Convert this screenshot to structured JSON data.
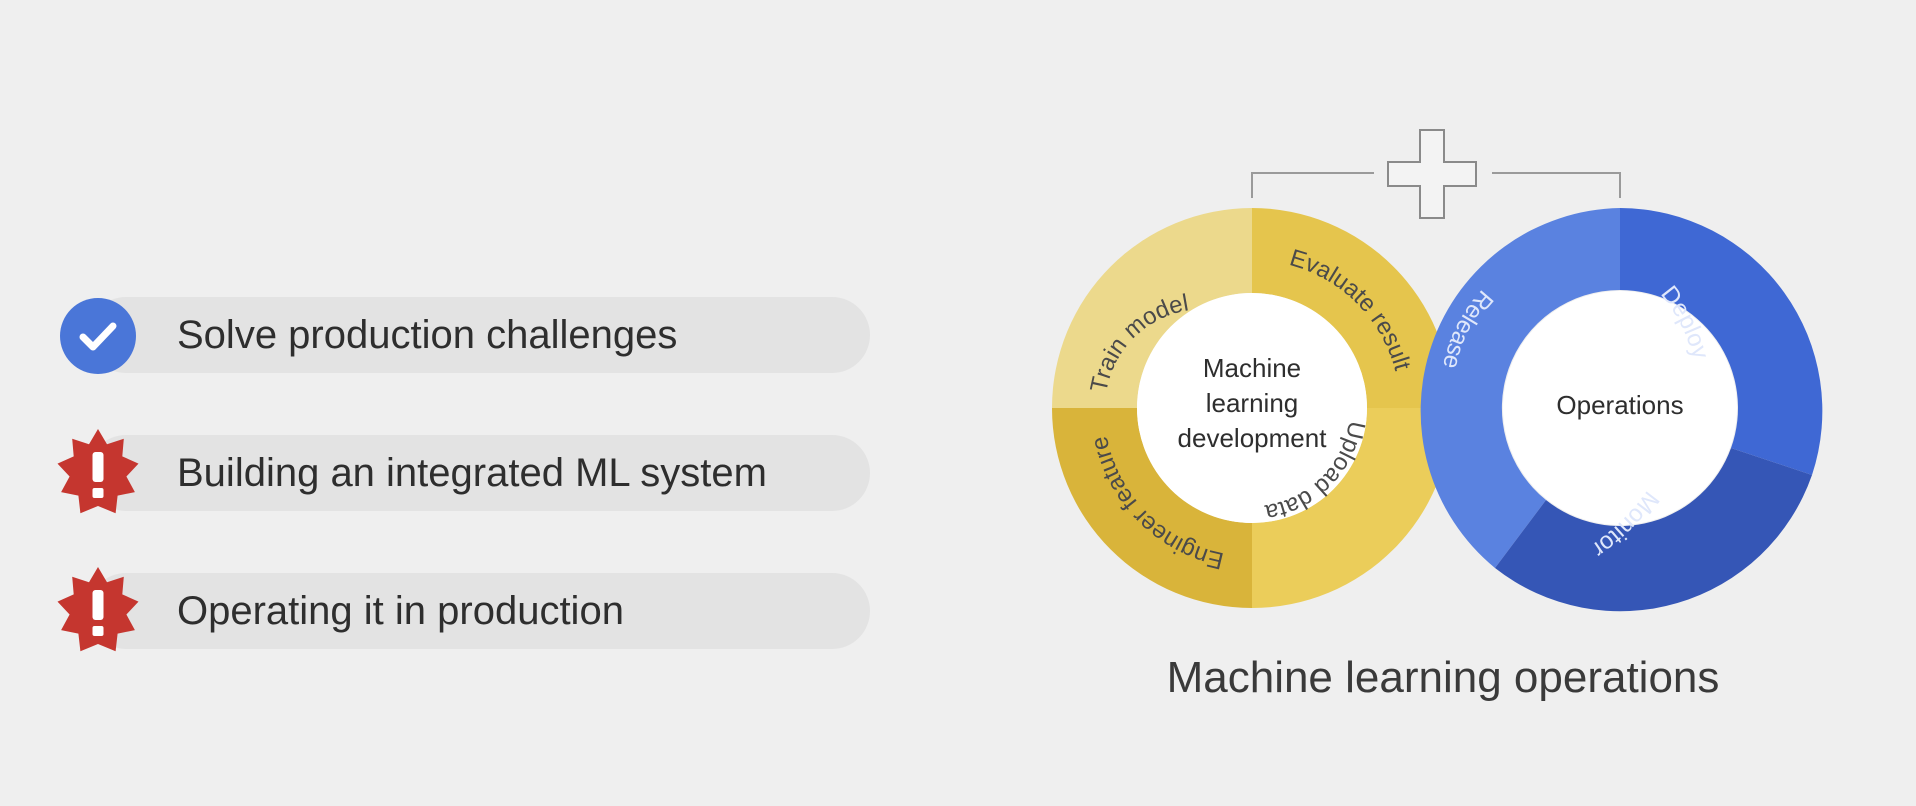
{
  "checklist": [
    {
      "label": "Solve production challenges",
      "icon": "check-circle-icon",
      "status": "done"
    },
    {
      "label": "Building an integrated ML system",
      "icon": "alert-badge-icon",
      "status": "warning"
    },
    {
      "label": "Operating it in production",
      "icon": "alert-badge-icon",
      "status": "warning"
    }
  ],
  "diagram": {
    "caption": "Machine learning operations",
    "combine_symbol": "plus-icon",
    "ml_development": {
      "center_label_lines": [
        "Machine",
        "learning",
        "development"
      ],
      "segments": [
        "Train model",
        "Evaluate result",
        "Upload data",
        "Engineer feature"
      ]
    },
    "operations": {
      "center_label": "Operations",
      "segments": [
        "Release",
        "Deploy",
        "Monitor"
      ]
    }
  },
  "colors": {
    "check": "#4a76d8",
    "alert": "#c5362f",
    "yellow_light": "#ecd98c",
    "yellow_mid": "#e5c54d",
    "yellow_dark": "#d9b43a",
    "blue_light": "#5a82e0",
    "blue_mid": "#3f68d4",
    "blue_dark": "#3556b6"
  }
}
